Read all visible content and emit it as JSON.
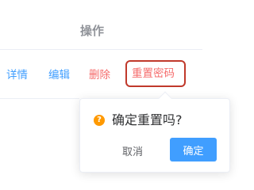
{
  "table": {
    "column_header": "操作",
    "actions": {
      "detail": "详情",
      "edit": "编辑",
      "delete": "删除",
      "reset_password": "重置密码"
    }
  },
  "popconfirm": {
    "icon": "warning-circle-icon",
    "message": "确定重置吗?",
    "cancel_label": "取消",
    "confirm_label": "确定"
  },
  "colors": {
    "link_primary": "#409eff",
    "link_danger": "#f56c6c",
    "confirm_button": "#409eff",
    "warning_icon": "#ff9900",
    "highlight_border": "#c0392b"
  }
}
